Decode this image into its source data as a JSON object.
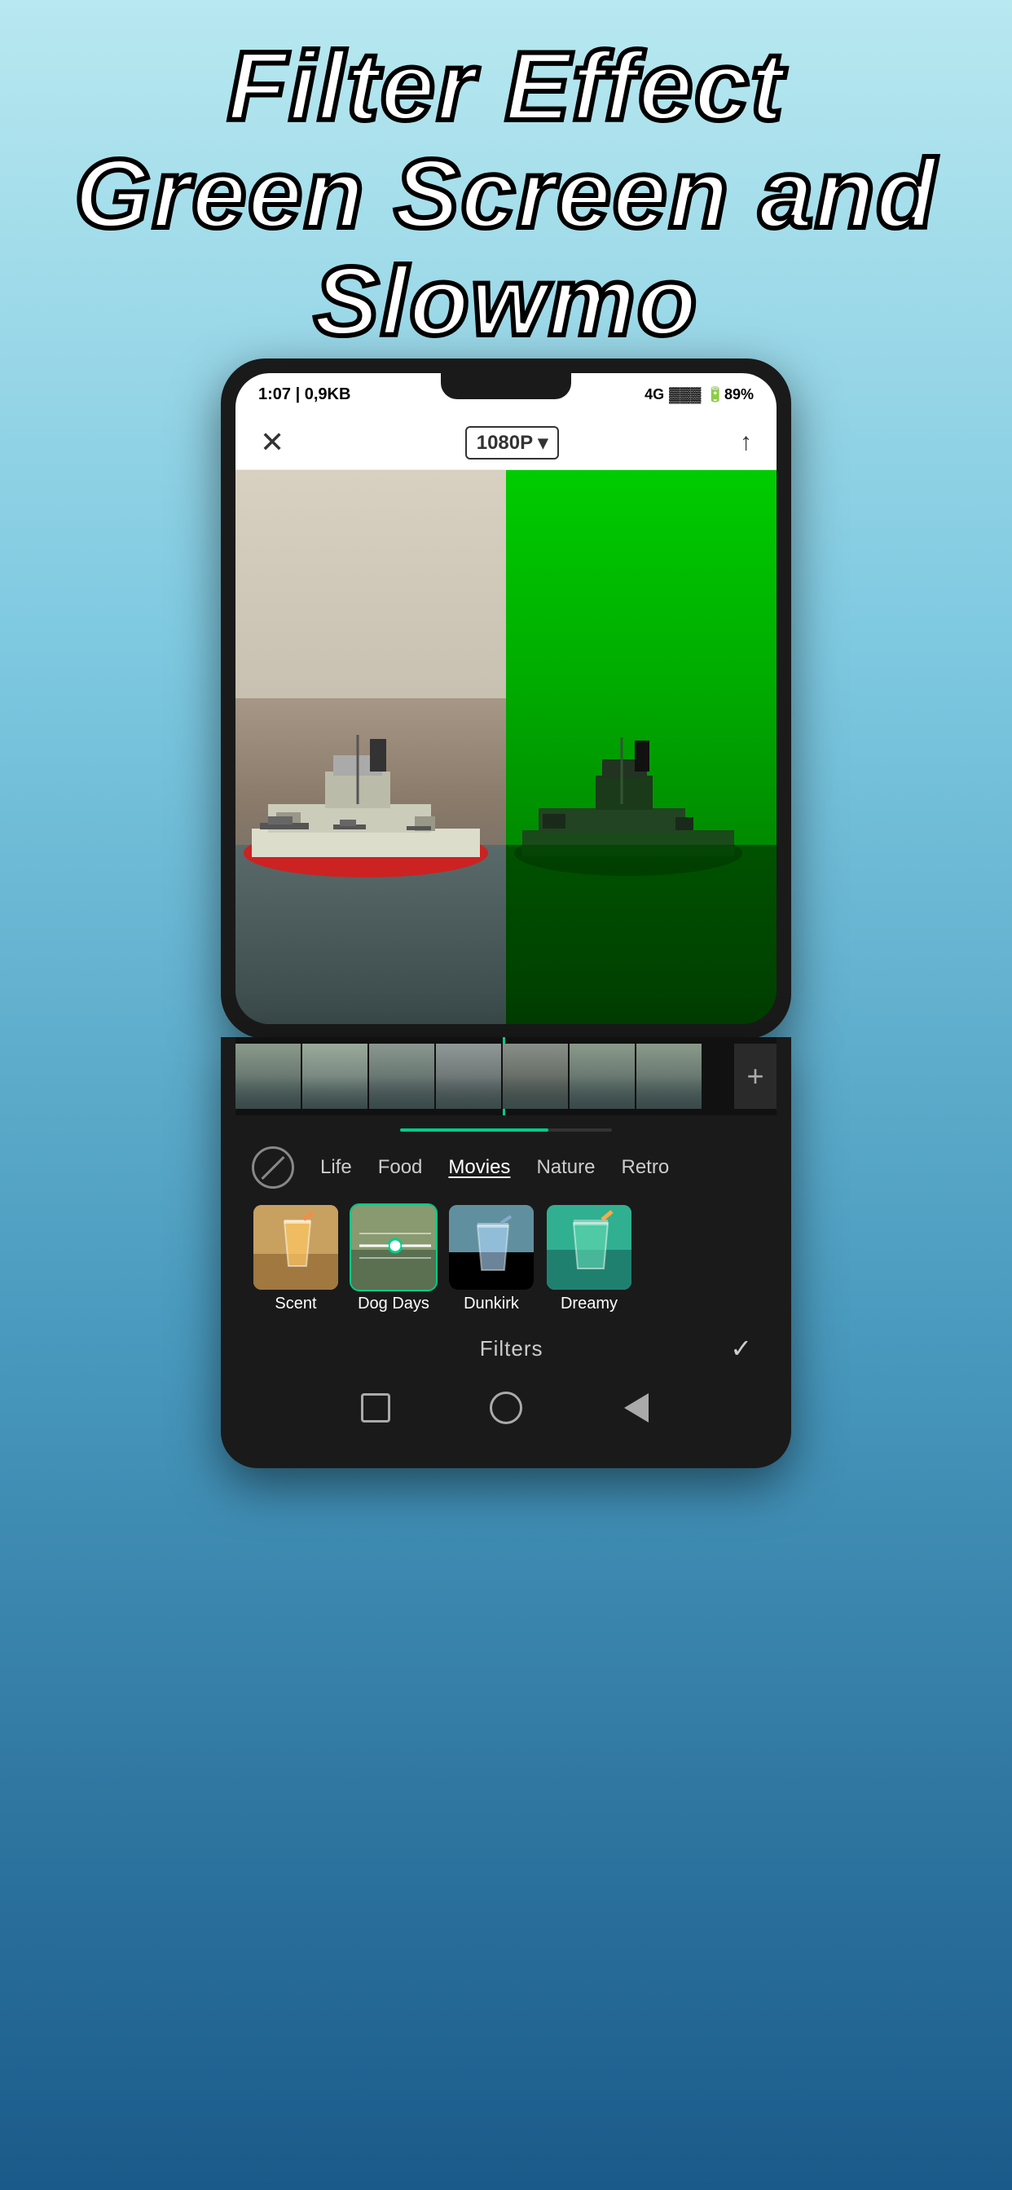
{
  "hero": {
    "line1": "Filter Effect",
    "line2": "Green Screen and Slowmo"
  },
  "status_bar": {
    "time": "1:07",
    "data": "0,9KB",
    "network": "4G",
    "battery": "89%"
  },
  "toolbar": {
    "resolution": "1080P ▾",
    "close_label": "✕",
    "export_label": "↑"
  },
  "timeline": {
    "add_label": "+"
  },
  "filter_section": {
    "categories": [
      {
        "id": "none",
        "label": ""
      },
      {
        "id": "life",
        "label": "Life"
      },
      {
        "id": "food",
        "label": "Food"
      },
      {
        "id": "movies",
        "label": "Movies",
        "active": true
      },
      {
        "id": "nature",
        "label": "Nature"
      },
      {
        "id": "retro",
        "label": "Retro"
      }
    ],
    "filters": [
      {
        "id": "scent",
        "label": "Scent",
        "style": "scent"
      },
      {
        "id": "dogdays",
        "label": "Dog Days",
        "style": "dogdays",
        "active": true
      },
      {
        "id": "dunkirk",
        "label": "Dunkirk",
        "style": "dunkirk"
      },
      {
        "id": "dreamy",
        "label": "Dreamy",
        "style": "dreamy"
      }
    ],
    "bottom_label": "Filters",
    "check_icon": "✓"
  }
}
